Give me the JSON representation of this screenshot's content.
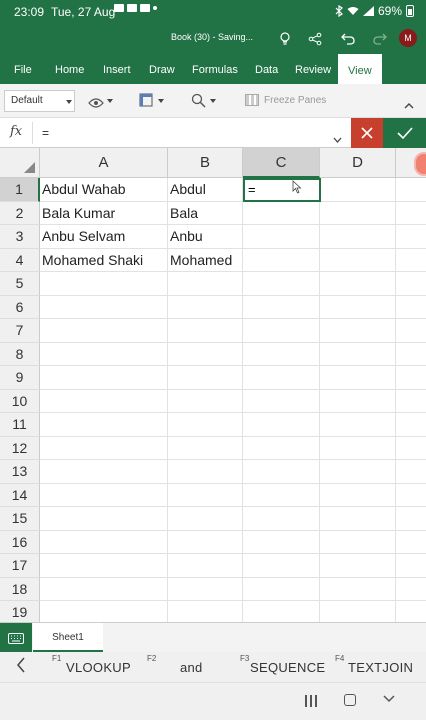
{
  "status": {
    "time": "23:09",
    "date": "Tue, 27 Aug",
    "battery": "69%"
  },
  "titlebar": {
    "doc_title": "Book (30) - Saving...",
    "avatar": "M"
  },
  "tabs": [
    {
      "label": "File",
      "active": false
    },
    {
      "label": "Home",
      "active": false
    },
    {
      "label": "Insert",
      "active": false
    },
    {
      "label": "Draw",
      "active": false
    },
    {
      "label": "Formulas",
      "active": false
    },
    {
      "label": "Data",
      "active": false
    },
    {
      "label": "Review",
      "active": false
    },
    {
      "label": "View",
      "active": true
    }
  ],
  "toolbar": {
    "style": "Default",
    "freeze": "Freeze Panes"
  },
  "formula": {
    "fx": "fx",
    "value": "="
  },
  "grid": {
    "columns": [
      "A",
      "B",
      "C",
      "D"
    ],
    "selected_column": "C",
    "rows": [
      "1",
      "2",
      "3",
      "4",
      "5",
      "6",
      "7",
      "8",
      "9",
      "10",
      "11",
      "12",
      "13",
      "14",
      "15",
      "16",
      "17",
      "18",
      "19"
    ],
    "selected_row": "1",
    "cells": [
      [
        "Abdul Wahab",
        "Abdul"
      ],
      [
        "Bala Kumar",
        "Bala"
      ],
      [
        "Anbu Selvam",
        "Anbu"
      ],
      [
        "Mohamed Shaki",
        "Mohamed"
      ]
    ],
    "active_cell": {
      "ref": "C1",
      "value": "="
    }
  },
  "sheets": {
    "active": "Sheet1"
  },
  "suggestions": [
    {
      "key": "F1",
      "label": "VLOOKUP"
    },
    {
      "key": "F2",
      "label": "and"
    },
    {
      "key": "F3",
      "label": "SEQUENCE"
    },
    {
      "key": "F4",
      "label": "TEXTJOIN"
    }
  ],
  "colors": {
    "accent": "#217346",
    "cancel": "#c7402d"
  }
}
